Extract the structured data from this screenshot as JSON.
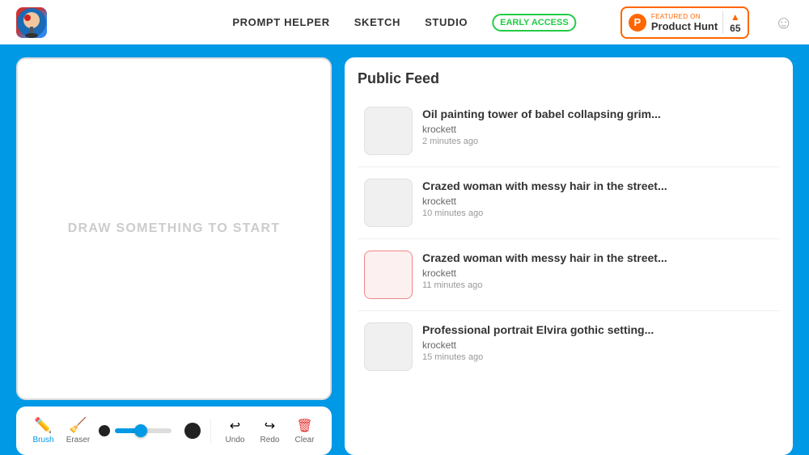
{
  "header": {
    "nav": {
      "prompt_helper": "PROMPT HELPER",
      "sketch": "SKETCH",
      "studio": "STUDIO",
      "early_access": "EARLY ACCESS"
    },
    "product_hunt": {
      "featured_label": "FEATURED ON",
      "name": "Product Hunt",
      "count": "65",
      "arrow": "▲"
    }
  },
  "canvas": {
    "placeholder": "DRAW SOMETHING TO START"
  },
  "toolbar": {
    "brush_label": "Brush",
    "eraser_label": "Eraser",
    "undo_label": "Undo",
    "redo_label": "Redo",
    "clear_label": "Clear"
  },
  "feed": {
    "title": "Public Feed",
    "items": [
      {
        "title": "Oil painting tower of babel collapsing grim...",
        "username": "krockett",
        "time": "2 minutes ago"
      },
      {
        "title": "Crazed woman with messy hair in the street...",
        "username": "krockett",
        "time": "10 minutes ago"
      },
      {
        "title": "Crazed woman with messy hair in the street...",
        "username": "krockett",
        "time": "11 minutes ago"
      },
      {
        "title": "Professional portrait Elvira gothic setting...",
        "username": "krockett",
        "time": "15 minutes ago"
      }
    ]
  }
}
